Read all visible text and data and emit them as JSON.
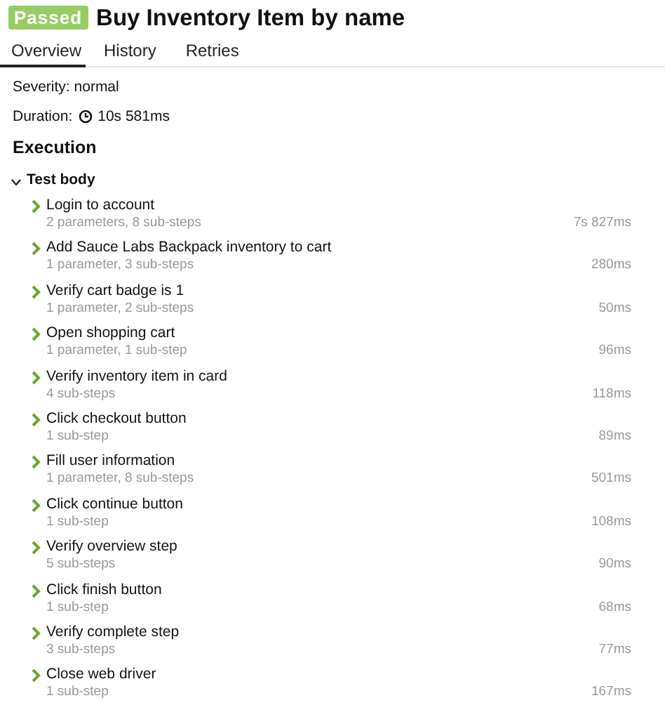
{
  "header": {
    "status": "Passed",
    "passed": true,
    "title": "Buy Inventory Item by name"
  },
  "tabs": [
    {
      "label": "Overview",
      "selected": true
    },
    {
      "label": "History",
      "selected": false
    },
    {
      "label": "Retries",
      "selected": false
    }
  ],
  "severity": "Severity: normal",
  "duration": {
    "label": "Duration:",
    "value": "10s 581ms"
  },
  "section_title": "Execution",
  "test_body": {
    "title": "Test body",
    "expanded": true,
    "steps": [
      {
        "name": "Login to account",
        "details": "2 parameters, 8 sub-steps",
        "time": "7s 827ms",
        "expanded": false
      },
      {
        "name": "Add Sauce Labs Backpack inventory to cart",
        "details": "1 parameter, 3 sub-steps",
        "time": "280ms",
        "expanded": false
      },
      {
        "name": "Verify cart badge is 1",
        "details": "1 parameter, 2 sub-steps",
        "time": "50ms",
        "expanded": false
      },
      {
        "name": "Open shopping cart",
        "details": "1 parameter, 1 sub-step",
        "time": "96ms",
        "expanded": false
      },
      {
        "name": "Verify inventory item in card",
        "details": "4 sub-steps",
        "time": "118ms",
        "expanded": false
      },
      {
        "name": "Click checkout button",
        "details": "1 sub-step",
        "time": "89ms",
        "expanded": false
      },
      {
        "name": "Fill user information",
        "details": "1 parameter, 8 sub-steps",
        "time": "501ms",
        "expanded": false
      },
      {
        "name": "Click continue button",
        "details": "1 sub-step",
        "time": "108ms",
        "expanded": false
      },
      {
        "name": "Verify overview step",
        "details": "5 sub-steps",
        "time": "90ms",
        "expanded": false
      },
      {
        "name": "Click finish button",
        "details": "1 sub-step",
        "time": "68ms",
        "expanded": false
      },
      {
        "name": "Verify complete step",
        "details": "3 sub-steps",
        "time": "77ms",
        "expanded": false
      },
      {
        "name": "Close web driver",
        "details": "1 sub-step",
        "time": "167ms",
        "expanded": false
      }
    ]
  }
}
